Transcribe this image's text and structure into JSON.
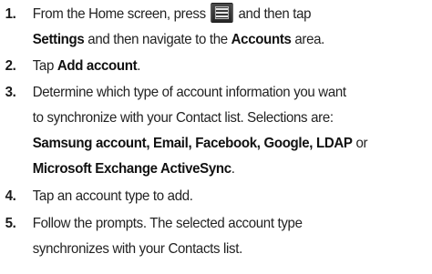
{
  "steps": [
    {
      "number": "1.",
      "line1_pre": "From the Home screen, press",
      "icon": "menu-key-icon",
      "line1_post": "and then tap",
      "line2_bold1": "Settings",
      "line2_text": " and then navigate to the ",
      "line2_bold2": "Accounts",
      "line2_end": " area."
    },
    {
      "number": "2.",
      "pre": "Tap ",
      "bold": "Add account",
      "end": "."
    },
    {
      "number": "3.",
      "line1": "Determine which type of account information you want",
      "line2": "to synchronize with your Contact list. Selections are:",
      "line3_bold": "Samsung account, Email, Facebook, Google, LDAP",
      "line3_or": " or",
      "line4_bold": "Microsoft Exchange ActiveSync",
      "line4_end": "."
    },
    {
      "number": "4.",
      "text": "Tap an account type to add."
    },
    {
      "number": "5.",
      "line1": "Follow the prompts. The selected account type",
      "line2": "synchronizes with your Contacts list."
    }
  ]
}
